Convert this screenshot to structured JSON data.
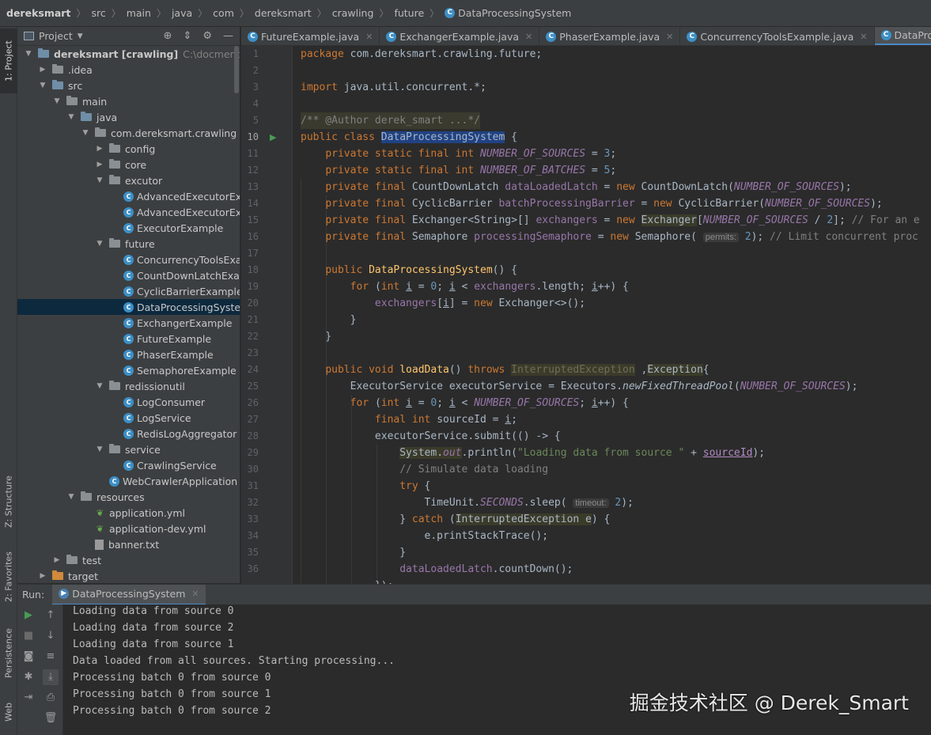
{
  "breadcrumb": [
    "dereksmart",
    "src",
    "main",
    "java",
    "com",
    "dereksmart",
    "crawling",
    "future",
    "DataProcessingSystem"
  ],
  "left_strip": {
    "project": "1: Project",
    "structure": "Z: Structure",
    "favorites": "2: Favorites",
    "persistence": "Persistence",
    "web": "Web"
  },
  "project": {
    "title": "Project",
    "root_label": "dereksmart [crawling]",
    "root_path": "C:\\docmentHisto",
    "tree": [
      {
        "label": "dereksmart [crawling]"
      },
      {
        "label": ".idea"
      },
      {
        "label": "src"
      },
      {
        "label": "main"
      },
      {
        "label": "java"
      },
      {
        "label": "com.dereksmart.crawling"
      },
      {
        "label": "config"
      },
      {
        "label": "core"
      },
      {
        "label": "excutor"
      },
      {
        "label": "AdvancedExecutorExar"
      },
      {
        "label": "AdvancedExecutorExar"
      },
      {
        "label": "ExecutorExample"
      },
      {
        "label": "future"
      },
      {
        "label": "ConcurrencyToolsExan"
      },
      {
        "label": "CountDownLatchExamp"
      },
      {
        "label": "CyclicBarrierExample"
      },
      {
        "label": "DataProcessingSystem"
      },
      {
        "label": "ExchangerExample"
      },
      {
        "label": "FutureExample"
      },
      {
        "label": "PhaserExample"
      },
      {
        "label": "SemaphoreExample"
      },
      {
        "label": "redissionutil"
      },
      {
        "label": "LogConsumer"
      },
      {
        "label": "LogService"
      },
      {
        "label": "RedisLogAggregator"
      },
      {
        "label": "service"
      },
      {
        "label": "CrawlingService"
      },
      {
        "label": "WebCrawlerApplication"
      },
      {
        "label": "resources"
      },
      {
        "label": "application.yml"
      },
      {
        "label": "application-dev.yml"
      },
      {
        "label": "banner.txt"
      },
      {
        "label": "test"
      },
      {
        "label": "target"
      }
    ]
  },
  "tabs": [
    "FutureExample.java",
    "ExchangerExample.java",
    "PhaserExample.java",
    "ConcurrencyToolsExample.java",
    "DataProcessingSys"
  ],
  "line_numbers": [
    "1",
    "2",
    "3",
    "4",
    "5",
    "10",
    "11",
    "12",
    "13",
    "14",
    "15",
    "16",
    "17",
    "18",
    "19",
    "20",
    "21",
    "22",
    "23",
    "24",
    "25",
    "26",
    "27",
    "28",
    "29",
    "30",
    "31",
    "32",
    "33",
    "34",
    "35",
    "36"
  ],
  "code": {
    "pkg": "package",
    "pkg_name": " com.dereksmart.crawling.future;",
    "import": "import",
    "import_name": " java.util.concurrent.*;",
    "doc": "/** @Author derek_smart ...*/",
    "class_kw": "public class ",
    "class_name": "DataProcessingSystem",
    "class_tail": " {",
    "hint_permits": "permits:",
    "hint_timeout": "timeout:"
  },
  "run": {
    "label": "Run:",
    "tab": "DataProcessingSystem",
    "output": [
      "Loading data from source 0",
      "Loading data from source 2",
      "Loading data from source 1",
      "Data loaded from all sources. Starting processing...",
      "Processing batch 0 from source 0",
      "Processing batch 0 from source 1",
      "Processing batch 0 from source 2"
    ]
  },
  "watermark": "掘金技术社区 @ Derek_Smart"
}
